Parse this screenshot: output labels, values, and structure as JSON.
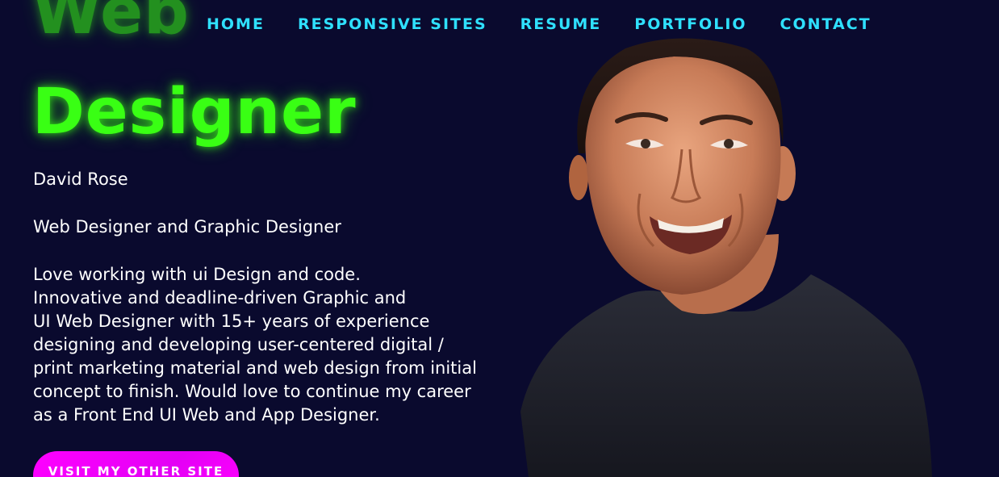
{
  "nav": {
    "items": [
      {
        "label": "HOME"
      },
      {
        "label": "RESPONSIVE SITES"
      },
      {
        "label": "RESUME"
      },
      {
        "label": "PORTFOLIO"
      },
      {
        "label": "CONTACT"
      }
    ]
  },
  "hero": {
    "title_line1": "Web",
    "title_line2": "Designer"
  },
  "profile": {
    "name": "David Rose",
    "role": "Web Designer and Graphic Designer",
    "bio_lines": [
      "Love working with ui Design and code.",
      "Innovative and deadline-driven Graphic and",
      "UI Web Designer with 15+ years of experience",
      "designing and developing user-centered digital /",
      "print marketing material and web design from initial",
      "concept to finish. Would love to continue my career",
      "as a Front End UI Web and App Designer."
    ]
  },
  "cta": {
    "label": "VISIT MY OTHER SITE"
  },
  "colors": {
    "background": "#0a0a2e",
    "nav_link": "#2fe0ff",
    "title_green": "#39ff14",
    "cta_magenta": "#ff00ff"
  },
  "icons": {
    "portrait": "portrait-photo"
  }
}
